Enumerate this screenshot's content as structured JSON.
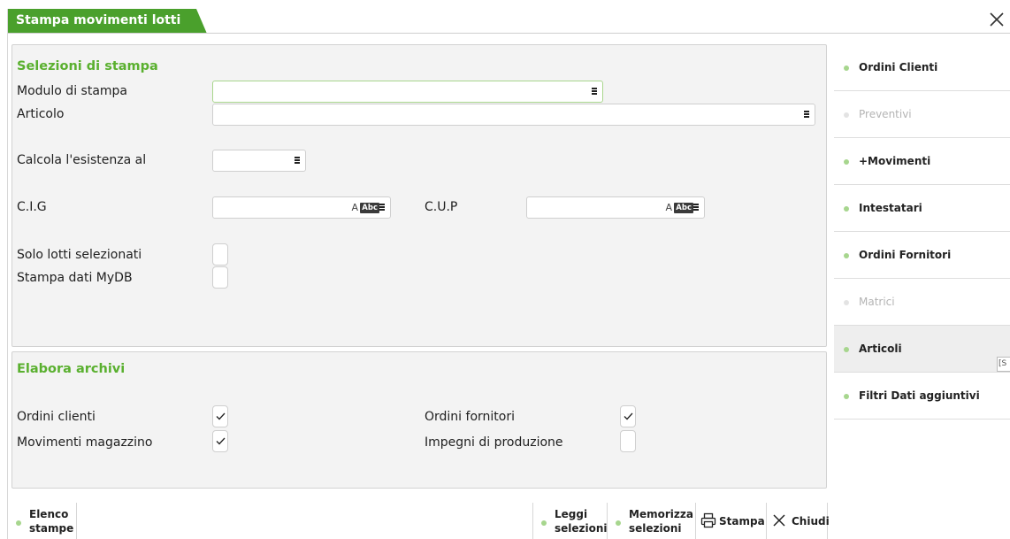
{
  "window": {
    "title": "Stampa movimenti lotti",
    "accent_color": "#4aa02c",
    "close_icon": "close-x-icon"
  },
  "selezioni": {
    "title": "Selezioni di stampa",
    "modulo_label": "Modulo di stampa",
    "modulo_value": "",
    "articolo_label": "Articolo",
    "articolo_value": "",
    "esistenza_label": "Calcola l'esistenza al",
    "esistenza_value": "",
    "cig_label": "C.I.G",
    "cig_value": "",
    "cup_label": "C.U.P",
    "cup_value": "",
    "abc_text": "Abc",
    "trans_text": "A",
    "solo_lotti_label": "Solo lotti selezionati",
    "solo_lotti_checked": false,
    "mydb_label": "Stampa dati MyDB",
    "mydb_checked": false
  },
  "archivi": {
    "title": "Elabora archivi",
    "ordini_clienti_label": "Ordini clienti",
    "ordini_clienti_checked": true,
    "movimenti_label": "Movimenti magazzino",
    "movimenti_checked": true,
    "ordini_fornitori_label": "Ordini fornitori",
    "ordini_fornitori_checked": true,
    "impegni_label": "Impegni di produzione",
    "impegni_checked": false
  },
  "sidebar": {
    "items": [
      {
        "label": "Ordini Clienti",
        "enabled": true
      },
      {
        "label": "Preventivi",
        "enabled": false
      },
      {
        "label": "+Movimenti",
        "enabled": true
      },
      {
        "label": "Intestatari",
        "enabled": true
      },
      {
        "label": "Ordini Fornitori",
        "enabled": true
      },
      {
        "label": "Matrici",
        "enabled": false
      },
      {
        "label": "Articoli",
        "enabled": true,
        "active": true
      },
      {
        "label": "Filtri Dati aggiuntivi",
        "enabled": true
      }
    ],
    "tooltip_fragment": "[S"
  },
  "bottom": {
    "elenco_line1": "Elenco",
    "elenco_line2": "stampe",
    "leggi_line1": "Leggi",
    "leggi_line2": "selezioni",
    "memorizza_line1": "Memorizza",
    "memorizza_line2": "selezioni",
    "stampa_label": "Stampa",
    "chiudi_label": "Chiudi",
    "stampa_icon": "printer-icon",
    "chiudi_icon": "close-x-icon"
  }
}
